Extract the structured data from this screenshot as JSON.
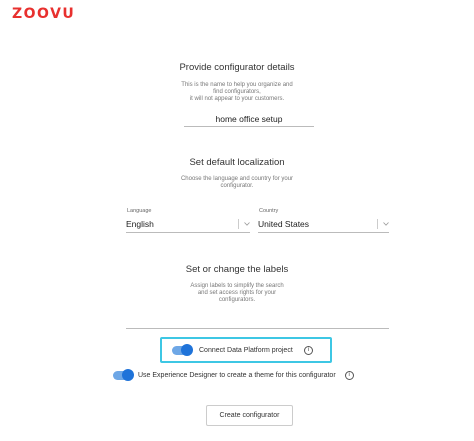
{
  "brand": {
    "logo_text": "ZOOVU",
    "accent": "#e8302e"
  },
  "details": {
    "title": "Provide configurator details",
    "description_line1": "This is the name to help you organize and",
    "description_line2": "find configurators,",
    "description_line3": "it will not appear to your customers.",
    "name_value": "home office setup"
  },
  "localization": {
    "title": "Set default localization",
    "description_line1": "Choose the language and country for your",
    "description_line2": "configurator.",
    "language_label": "Language",
    "language_value": "English",
    "country_label": "Country",
    "country_value": "United States"
  },
  "labels": {
    "title": "Set or change the labels",
    "description_line1": "Assign labels to simplify the search",
    "description_line2": "and set access rights for your",
    "description_line3": "configurators.",
    "input_value": ""
  },
  "toggles": {
    "data_platform_label": "Connect Data Platform project",
    "experience_designer_label": "Use Experience Designer to create a theme for this configurator",
    "toggle_color": "#1f73d9",
    "highlight_color": "#3dc7e4",
    "info_glyph": "i"
  },
  "actions": {
    "create_label": "Create configurator"
  }
}
